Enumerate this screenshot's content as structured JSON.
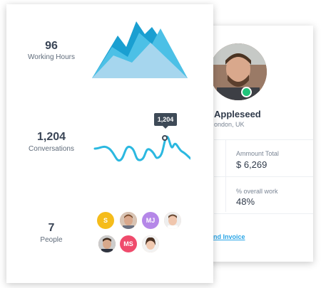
{
  "stats": {
    "working_hours": {
      "value": "96",
      "label": "Working Hours"
    },
    "conversations": {
      "value": "1,204",
      "label": "Conversations",
      "tooltip": "1,204"
    },
    "people": {
      "value": "7",
      "label": "People"
    }
  },
  "people_avatars": [
    {
      "initials": "S",
      "color": "#f5bc1b",
      "kind": "initials"
    },
    {
      "initials": "",
      "color": "#c9967a",
      "kind": "photo"
    },
    {
      "initials": "MJ",
      "color": "#b587e8",
      "kind": "initials"
    },
    {
      "initials": "",
      "color": "#e8b9a3",
      "kind": "photo"
    },
    {
      "initials": "",
      "color": "#a77d63",
      "kind": "photo"
    },
    {
      "initials": "MS",
      "color": "#ef4b6c",
      "kind": "initials"
    },
    {
      "initials": "",
      "color": "#dcb39a",
      "kind": "photo"
    }
  ],
  "profile": {
    "name": "Appleseed",
    "location": "ondon, UK",
    "status_color": "#21c47b",
    "amount_label": "Ammount Total",
    "amount_value": "$ 6,269",
    "work_label": "% overall work",
    "work_value": "48%",
    "link_label": "nd Invoice"
  },
  "colors": {
    "accent": "#2aa5e6",
    "mountain_dark": "#1a9fd1",
    "mountain_light": "#9fd4ee",
    "line": "#2bb8e0"
  }
}
